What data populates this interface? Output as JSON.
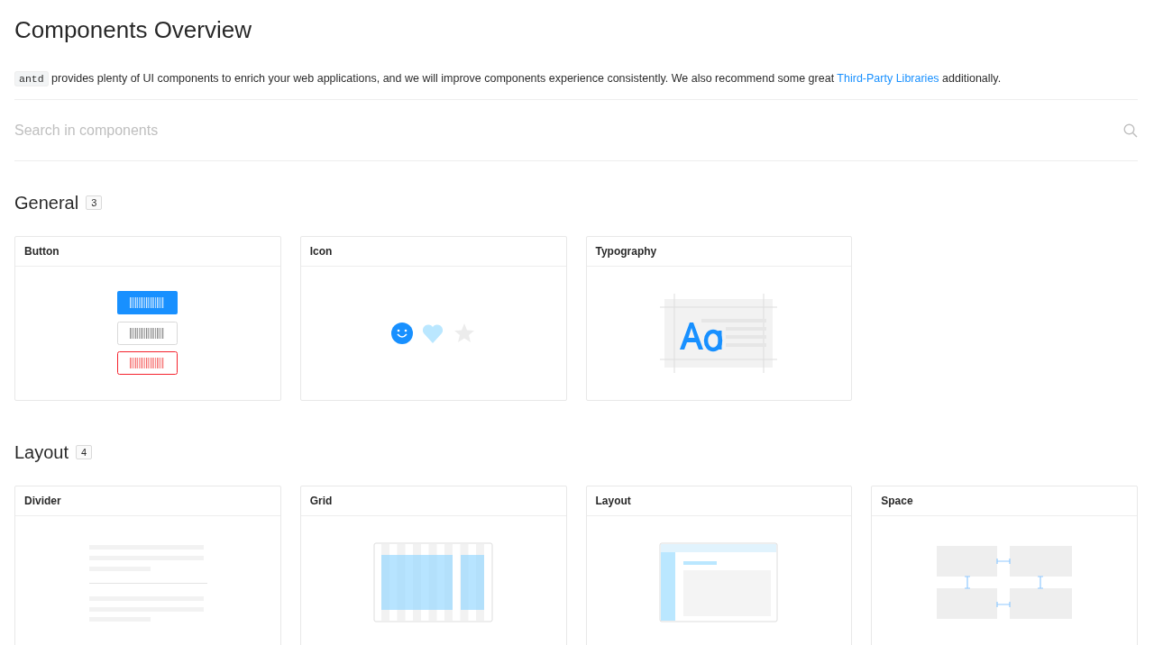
{
  "title": "Components Overview",
  "intro": {
    "code": "antd",
    "text": " provides plenty of UI components to enrich your web applications, and we will improve components experience consistently. We also recommend some great ",
    "link": "Third-Party Libraries",
    "tail": " additionally."
  },
  "search": {
    "placeholder": "Search in components"
  },
  "sections": [
    {
      "title": "General",
      "count": "3",
      "cards": [
        {
          "title": "Button",
          "kind": "button"
        },
        {
          "title": "Icon",
          "kind": "icon"
        },
        {
          "title": "Typography",
          "kind": "typography"
        }
      ]
    },
    {
      "title": "Layout",
      "count": "4",
      "cards": [
        {
          "title": "Divider",
          "kind": "divider"
        },
        {
          "title": "Grid",
          "kind": "grid"
        },
        {
          "title": "Layout",
          "kind": "layout"
        },
        {
          "title": "Space",
          "kind": "space"
        }
      ]
    }
  ]
}
